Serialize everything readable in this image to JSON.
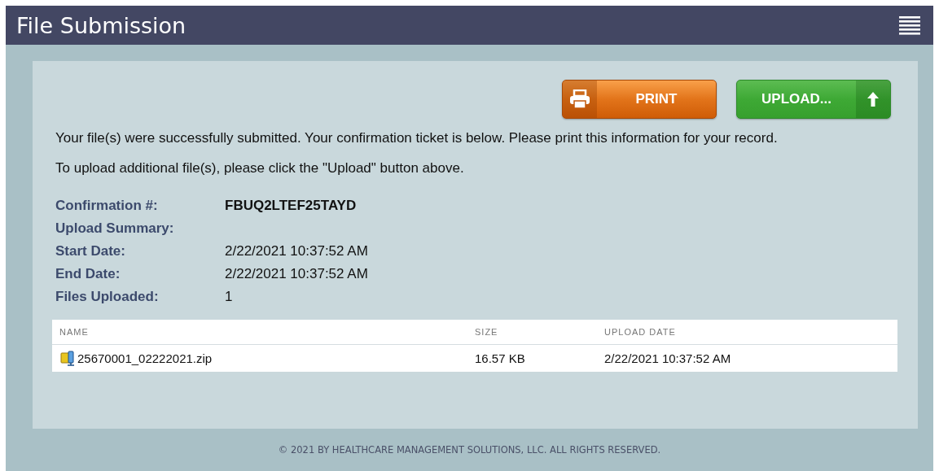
{
  "header": {
    "title": "File Submission"
  },
  "buttons": [
    {
      "kind": "print",
      "label": "PRINT"
    },
    {
      "kind": "upload",
      "label": "UPLOAD..."
    }
  ],
  "messages": [
    "Your file(s) were successfully submitted. Your confirmation ticket is below. Please print this information for your record.",
    "To upload additional file(s), please click the \"Upload\" button above."
  ],
  "confirmation": {
    "label": "Confirmation #:",
    "value": "FBUQ2LTEF25TAYD"
  },
  "summary": [
    {
      "label": "Upload Summary:"
    },
    {
      "label": "Start Date:",
      "value": "2/22/2021 10:37:52 AM"
    },
    {
      "label": "End Date:",
      "value": "2/22/2021 10:37:52 AM"
    },
    {
      "label": "Files Uploaded:",
      "value": "1"
    }
  ],
  "table": {
    "columns": [
      "NAME",
      "SIZE",
      "UPLOAD DATE"
    ],
    "rows": [
      [
        "25670001_02222021.zip",
        "16.57 KB",
        "2/22/2021 10:37:52 AM"
      ]
    ]
  },
  "footer": "© 2021 BY HEALTHCARE MANAGEMENT SOLUTIONS, LLC. ALL RIGHTS RESERVED."
}
